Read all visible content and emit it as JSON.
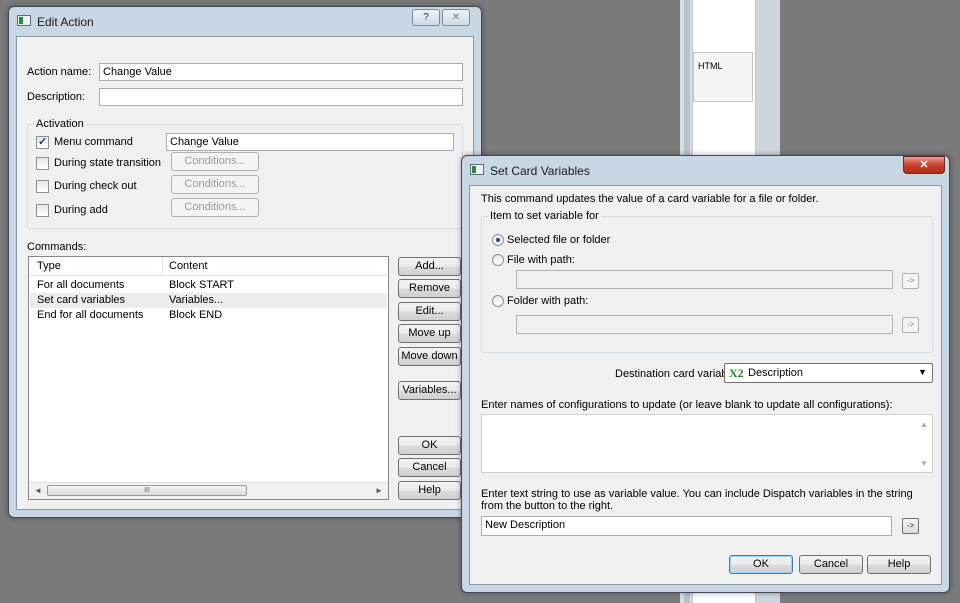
{
  "background": {
    "html_tab_label": "HTML"
  },
  "edit_action": {
    "title": "Edit Action",
    "caption_help": "?",
    "caption_close": "✕",
    "action_name_label": "Action name:",
    "action_name_value": "Change Value",
    "description_label": "Description:",
    "description_value": "",
    "activation": {
      "group_title": "Activation",
      "menu_command_label": "Menu command",
      "menu_command_checked": true,
      "menu_command_value": "Change Value",
      "during_state_transition_label": "During state transition",
      "during_check_out_label": "During check out",
      "during_add_label": "During add",
      "conditions_label": "Conditions..."
    },
    "commands": {
      "label": "Commands:",
      "columns": [
        "Type",
        "Content"
      ],
      "rows": [
        {
          "type": "For all documents",
          "content": "Block START"
        },
        {
          "type": "Set card variables",
          "content": "Variables..."
        },
        {
          "type": "End for all documents",
          "content": "Block END"
        }
      ],
      "selected_row": 1
    },
    "buttons": {
      "add": "Add...",
      "remove": "Remove",
      "edit": "Edit...",
      "move_up": "Move up",
      "move_down": "Move down",
      "variables": "Variables...",
      "ok": "OK",
      "cancel": "Cancel",
      "help": "Help"
    },
    "scroll": {
      "left": "◄",
      "right": "►",
      "grip": "III"
    }
  },
  "set_card_variables": {
    "title": "Set Card Variables",
    "caption_close": "✕",
    "intro": "This command updates the value of a card variable for a file or folder.",
    "item_group_title": "Item to set variable for",
    "selected_option_label": "Selected file or folder",
    "file_with_path_label": "File with path:",
    "file_path_value": "",
    "folder_with_path_label": "Folder with path:",
    "folder_path_value": "",
    "arrow_button_label": "->",
    "destination_label": "Destination card variable:",
    "destination_icon_text": "X2",
    "destination_value": "Description",
    "dropdown_arrow": "▼",
    "configs_label": "Enter names of configurations to update (or leave blank to update all configurations):",
    "configs_value": "",
    "value_label": "Enter text string to use as variable value. You can include Dispatch variables in the string from the button to the right.",
    "value_value": "New Description",
    "buttons": {
      "ok": "OK",
      "cancel": "Cancel",
      "help": "Help"
    },
    "scroll": {
      "up": "▲",
      "down": "▼"
    }
  }
}
